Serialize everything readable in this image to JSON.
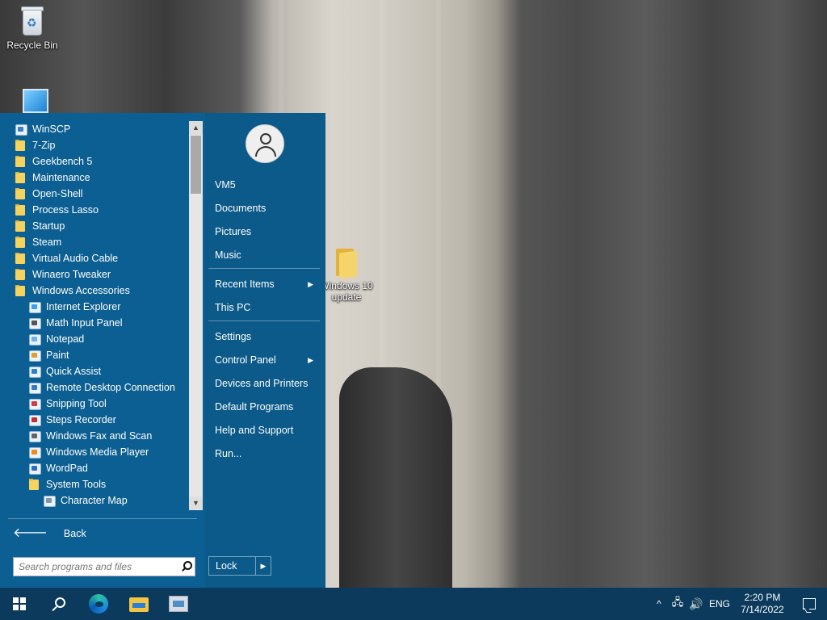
{
  "desktop": {
    "icons": [
      {
        "label": "Recycle Bin",
        "icon": "recycle-bin-icon"
      },
      {
        "label": "Windows 10 update",
        "icon": "folder-icon"
      }
    ]
  },
  "start_menu": {
    "programs": [
      {
        "label": "WinSCP",
        "icon": "winscp-icon",
        "level": 0
      },
      {
        "label": "7-Zip",
        "icon": "folder-icon",
        "level": 0
      },
      {
        "label": "Geekbench 5",
        "icon": "folder-icon",
        "level": 0
      },
      {
        "label": "Maintenance",
        "icon": "folder-icon",
        "level": 0
      },
      {
        "label": "Open-Shell",
        "icon": "folder-icon",
        "level": 0
      },
      {
        "label": "Process Lasso",
        "icon": "folder-icon",
        "level": 0
      },
      {
        "label": "Startup",
        "icon": "folder-icon",
        "level": 0
      },
      {
        "label": "Steam",
        "icon": "folder-icon",
        "level": 0
      },
      {
        "label": "Virtual Audio Cable",
        "icon": "folder-icon",
        "level": 0
      },
      {
        "label": "Winaero Tweaker",
        "icon": "folder-icon",
        "level": 0
      },
      {
        "label": "Windows Accessories",
        "icon": "folder-icon",
        "level": 0
      },
      {
        "label": "Internet Explorer",
        "icon": "internet-explorer-icon",
        "level": 1
      },
      {
        "label": "Math Input Panel",
        "icon": "math-input-panel-icon",
        "level": 1
      },
      {
        "label": "Notepad",
        "icon": "notepad-icon",
        "level": 1
      },
      {
        "label": "Paint",
        "icon": "paint-icon",
        "level": 1
      },
      {
        "label": "Quick Assist",
        "icon": "quick-assist-icon",
        "level": 1
      },
      {
        "label": "Remote Desktop Connection",
        "icon": "remote-desktop-icon",
        "level": 1
      },
      {
        "label": "Snipping Tool",
        "icon": "snipping-tool-icon",
        "level": 1
      },
      {
        "label": "Steps Recorder",
        "icon": "steps-recorder-icon",
        "level": 1
      },
      {
        "label": "Windows Fax and Scan",
        "icon": "fax-scan-icon",
        "level": 1
      },
      {
        "label": "Windows Media Player",
        "icon": "media-player-icon",
        "level": 1
      },
      {
        "label": "WordPad",
        "icon": "wordpad-icon",
        "level": 1
      },
      {
        "label": "System Tools",
        "icon": "folder-icon",
        "level": 1
      },
      {
        "label": "Character Map",
        "icon": "character-map-icon",
        "level": 2
      }
    ],
    "back_label": "Back",
    "search_placeholder": "Search programs and files",
    "places": [
      {
        "label": "VM5",
        "submenu": false
      },
      {
        "label": "Documents",
        "submenu": false
      },
      {
        "label": "Pictures",
        "submenu": false
      },
      {
        "label": "Music",
        "submenu": false
      },
      {
        "label": "Recent Items",
        "submenu": true
      },
      {
        "label": "This PC",
        "submenu": false
      },
      {
        "label": "Settings",
        "submenu": false
      },
      {
        "label": "Control Panel",
        "submenu": true
      },
      {
        "label": "Devices and Printers",
        "submenu": false
      },
      {
        "label": "Default Programs",
        "submenu": false
      },
      {
        "label": "Help and Support",
        "submenu": false
      },
      {
        "label": "Run...",
        "submenu": false
      }
    ],
    "lock_label": "Lock",
    "colors": {
      "panel": "#0c5f92",
      "panel_dark": "#0b5a8a"
    }
  },
  "taskbar": {
    "pinned": [
      "start-icon",
      "search-icon",
      "edge-icon",
      "file-explorer-icon",
      "app-icon"
    ],
    "tray": {
      "chevron": "^",
      "language": "ENG",
      "time": "2:20 PM",
      "date": "7/14/2022"
    },
    "color": "#0b3a5c"
  }
}
